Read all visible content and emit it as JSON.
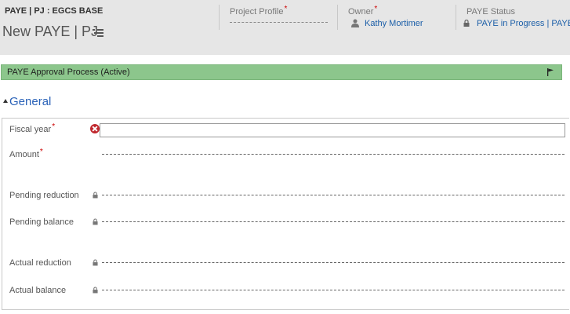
{
  "header": {
    "entity_type": "PAYE | PJ : EGCS BASE",
    "record_title": "New PAYE | PJ",
    "required_marker": "*",
    "fields": [
      {
        "label": "Project Profile",
        "required": true,
        "value": ""
      },
      {
        "label": "Owner",
        "required": true,
        "value": "Kathy Mortimer",
        "icon": "user-icon"
      },
      {
        "label": "PAYE Status",
        "required": false,
        "value": "PAYE in Progress | PAYE in",
        "icon": "lock-icon"
      }
    ]
  },
  "process_bar": {
    "label": "PAYE Approval Process (Active)",
    "icon": "flag-icon",
    "color": "#8cc68c"
  },
  "section": {
    "title": "General",
    "toggle_icon": "collapse-triangle-icon"
  },
  "form": {
    "fields": [
      {
        "label": "Fiscal year",
        "required": true,
        "value": "",
        "state": "error",
        "icon": "error-icon"
      },
      {
        "label": "Amount",
        "required": true,
        "value": ""
      },
      {
        "label": "Pending reduction",
        "required": false,
        "value": "",
        "locked": true
      },
      {
        "label": "Pending balance",
        "required": false,
        "value": "",
        "locked": true
      },
      {
        "label": "Actual reduction",
        "required": false,
        "value": "",
        "locked": true
      },
      {
        "label": "Actual balance",
        "required": false,
        "value": "",
        "locked": true
      }
    ]
  },
  "colors": {
    "header_bg": "#e6e6e6",
    "link": "#1c5fa8",
    "section_title": "#2a62b8",
    "required": "#cc0000",
    "error": "#c0272d"
  }
}
